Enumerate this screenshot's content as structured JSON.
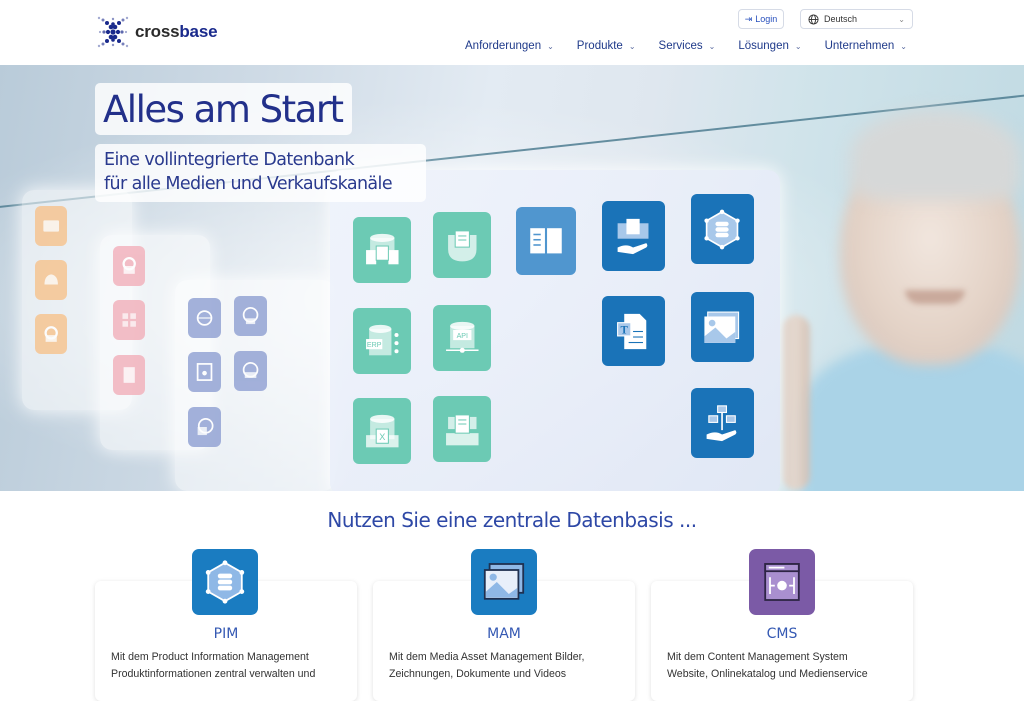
{
  "brand": {
    "name_part1": "cross",
    "name_part2": "base"
  },
  "header": {
    "login_label": "Login",
    "language": {
      "selected": "Deutsch"
    }
  },
  "nav": {
    "items": [
      {
        "label": "Anforderungen"
      },
      {
        "label": "Produkte"
      },
      {
        "label": "Services"
      },
      {
        "label": "Lösungen"
      },
      {
        "label": "Unternehmen"
      }
    ]
  },
  "hero": {
    "title": "Alles am Start",
    "subtitle_line1": "Eine vollintegrierte Datenbank",
    "subtitle_line2": "für alle Medien und Verkaufskanäle",
    "tiles_main": [
      "database-import-icon",
      "document-distribution-icon",
      "catalog-book-icon",
      "publishing-hand-icon",
      "pim-hub-icon",
      "erp-icon",
      "api-icon",
      "text-document-icon",
      "image-gallery-icon",
      "excel-import-icon",
      "table-import-icon",
      "workflow-hand-icon"
    ],
    "tiles_side": [
      "translation-icon",
      "translation-cloud-icon",
      "translation-settings-icon",
      "print-settings-icon",
      "office-formats-icon",
      "document-merge-icon",
      "web-click-icon",
      "web-analytics-icon",
      "cms-icon",
      "webshop-icon",
      "web-image-icon"
    ]
  },
  "section": {
    "title": "Nutzen Sie eine zentrale Datenbasis ..."
  },
  "cards": [
    {
      "title": "PIM",
      "line1": "Mit dem Product Information Management",
      "line2": "Produktinformationen zentral verwalten und",
      "color": "#1a7cc1"
    },
    {
      "title": "MAM",
      "line1": "Mit dem Media Asset Management Bilder,",
      "line2": "Zeichnungen, Dokumente und Videos",
      "color": "#1a7cc1"
    },
    {
      "title": "CMS",
      "line1": "Mit dem Content Management System",
      "line2": "Website, Onlinekatalog und Medienservice",
      "color": "#7b5aa6"
    }
  ],
  "colors": {
    "brand_blue": "#1a2a8c",
    "nav_text": "#1f3a8a",
    "teal_tile": "#6ccab4",
    "blue_tile": "#1a73b8",
    "cms_purple": "#7b5aa6"
  }
}
